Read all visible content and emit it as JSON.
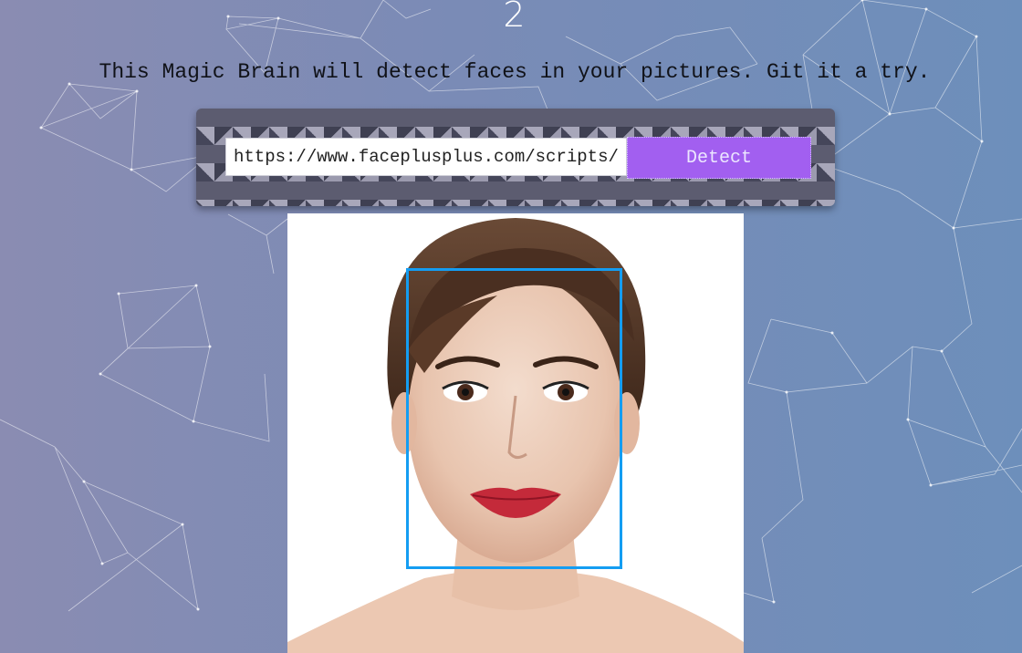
{
  "header": {
    "entry_count": "2",
    "tagline": "This Magic Brain will detect faces in your pictures. Git it a try."
  },
  "form": {
    "url_value": "https://www.faceplusplus.com/scripts/",
    "button_label": "Detect"
  },
  "detection": {
    "faces_detected": 1
  },
  "colors": {
    "accent_button": "#a25ff0",
    "bounding_box": "#149df2"
  },
  "icons": {
    "background": "particle-network-background",
    "photo": "woman-face-photo"
  }
}
